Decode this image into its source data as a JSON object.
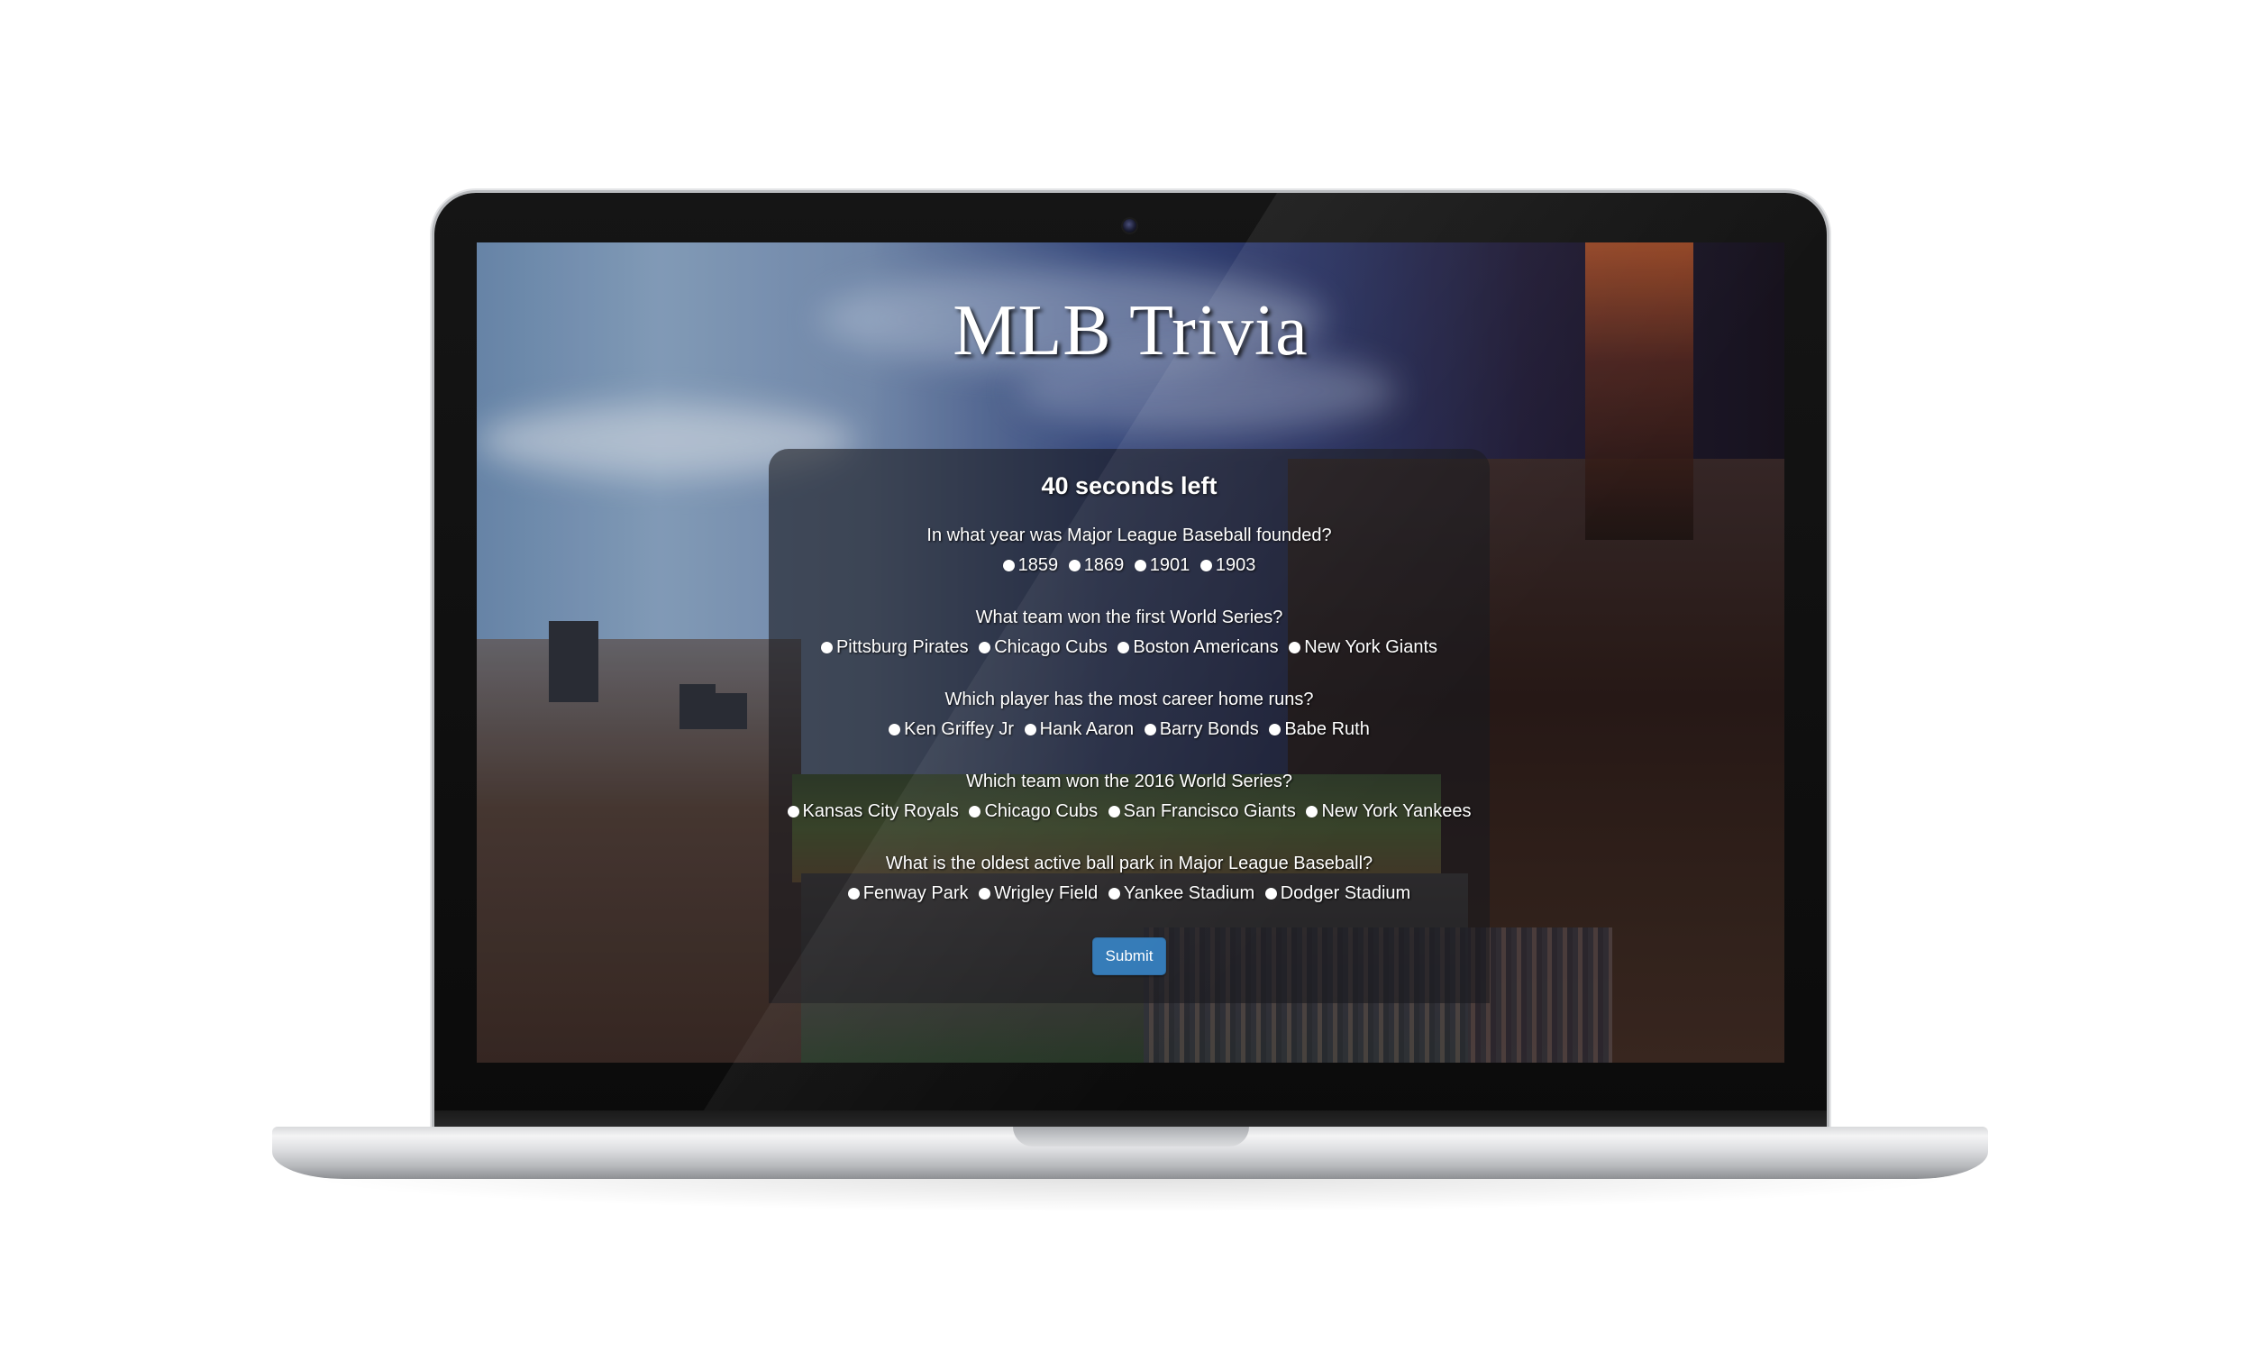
{
  "page": {
    "title": "MLB Trivia",
    "timer": "40 seconds left",
    "submit_label": "Submit"
  },
  "quiz": {
    "questions": [
      {
        "text": "In what year was Major League Baseball founded?",
        "options": [
          "1859",
          "1869",
          "1901",
          "1903"
        ]
      },
      {
        "text": "What team won the first World Series?",
        "options": [
          "Pittsburg Pirates",
          "Chicago Cubs",
          "Boston Americans",
          "New York Giants"
        ]
      },
      {
        "text": "Which player has the most career home runs?",
        "options": [
          "Ken Griffey Jr",
          "Hank Aaron",
          "Barry Bonds",
          "Babe Ruth"
        ]
      },
      {
        "text": "Which team won the 2016 World Series?",
        "options": [
          "Kansas City Royals",
          "Chicago Cubs",
          "San Francisco Giants",
          "New York Yankees"
        ]
      },
      {
        "text": "What is the oldest active ball park in Major League Baseball?",
        "options": [
          "Fenway Park",
          "Wrigley Field",
          "Yankee Stadium",
          "Dodger Stadium"
        ]
      }
    ]
  },
  "colors": {
    "submit_button": "#337ab7",
    "panel_overlay": "rgba(25,25,30,0.60)",
    "text": "#ffffff"
  }
}
